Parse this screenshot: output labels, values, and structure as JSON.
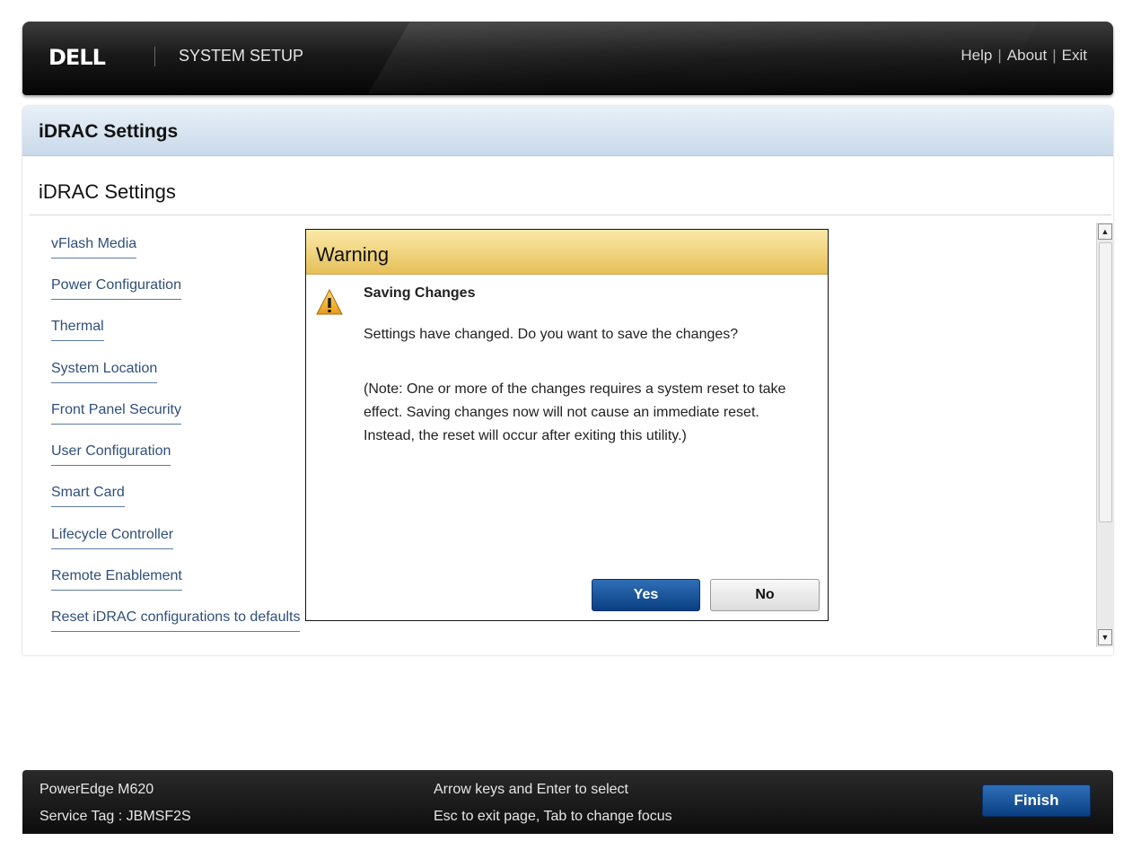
{
  "header": {
    "logo_text": "DELL",
    "title": "SYSTEM SETUP",
    "links": {
      "help": "Help",
      "about": "About",
      "exit": "Exit",
      "separator": "|"
    }
  },
  "page": {
    "header_title": "iDRAC Settings",
    "sub_title": "iDRAC Settings",
    "menu_items": [
      "vFlash Media",
      "Power Configuration",
      "Thermal",
      "System Location",
      "Front Panel Security",
      "User Configuration",
      "Smart Card",
      "Lifecycle Controller",
      "Remote Enablement",
      "Reset iDRAC configurations to defaults"
    ]
  },
  "dialog": {
    "title": "Warning",
    "icon": "warning-icon",
    "subject": "Saving Changes",
    "message": "Settings have changed. Do you want to save the changes?",
    "note": "(Note: One or more of the changes requires a system reset to take effect. Saving changes now will not cause an immediate reset. Instead, the reset will occur after exiting this utility.)",
    "yes_label": "Yes",
    "no_label": "No"
  },
  "footer": {
    "model": "PowerEdge M620",
    "service_tag": "Service Tag : JBMSF2S",
    "hint_1": "Arrow keys and Enter to select",
    "hint_2": "Esc to exit page, Tab to change focus",
    "finish_label": "Finish"
  },
  "colors": {
    "accent_blue": "#0a3f82",
    "dialog_header": "#e6c05a",
    "link": "#2f4f7a"
  }
}
